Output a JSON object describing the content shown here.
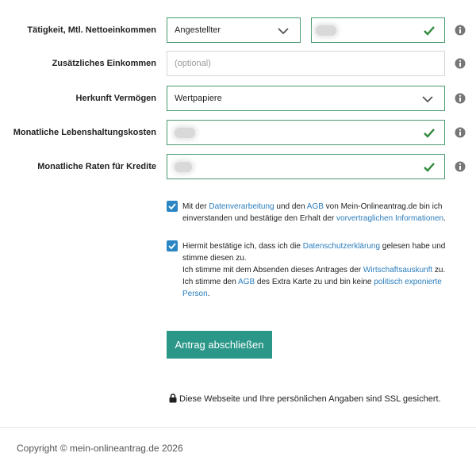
{
  "form": {
    "employment": {
      "label": "Tätigkeit, Mtl. Nettoeinkommen",
      "select_value": "Angestellter",
      "income_value": ""
    },
    "additional_income": {
      "label": "Zusätzliches Einkommen",
      "placeholder": "(optional)"
    },
    "asset_origin": {
      "label": "Herkunft Vermögen",
      "select_value": "Wertpapiere"
    },
    "living_costs": {
      "label": "Monatliche Lebenshaltungskosten",
      "value": ""
    },
    "loan_rates": {
      "label": "Monatliche Raten für Kredite",
      "value": ""
    }
  },
  "consent": {
    "first": {
      "t1": "Mit der ",
      "link1": "Datenverarbeitung",
      "t2": " und den ",
      "link2": "AGB",
      "t3": " von Mein-Onlineantrag.de bin ich einverstanden und bestätige den Erhalt der ",
      "link3": "vorvertraglichen Informationen",
      "t4": "."
    },
    "second": {
      "t1": "Hiermit bestätige ich, dass ich die ",
      "link1": "Datenschutzerklärung",
      "t2": " gelesen habe und stimme diesen zu.",
      "t3": "Ich stimme mit dem Absenden dieses Antrages der ",
      "link2": "Wirtschaftsauskunft",
      "t4": " zu.",
      "t5": "Ich stimme den ",
      "link3": "AGB",
      "t6": " des Extra Karte zu und bin keine ",
      "link4": "politisch exponierte Person",
      "t7": "."
    }
  },
  "submit_label": "Antrag abschließen",
  "ssl_notice": "Diese Webseite und Ihre persönlichen Angaben sind SSL gesichert.",
  "footer": {
    "copyright": "Copyright © mein-onlineantrag.de 2026"
  },
  "colors": {
    "valid_border": "#4a9a72",
    "check_green": "#2f8a3a",
    "checkbox_blue": "#2b86c4",
    "link_blue": "#2b7dbc",
    "submit_teal": "#2b9789"
  },
  "icons": [
    "chevron-down-icon",
    "check-icon",
    "info-icon",
    "lock-icon"
  ]
}
